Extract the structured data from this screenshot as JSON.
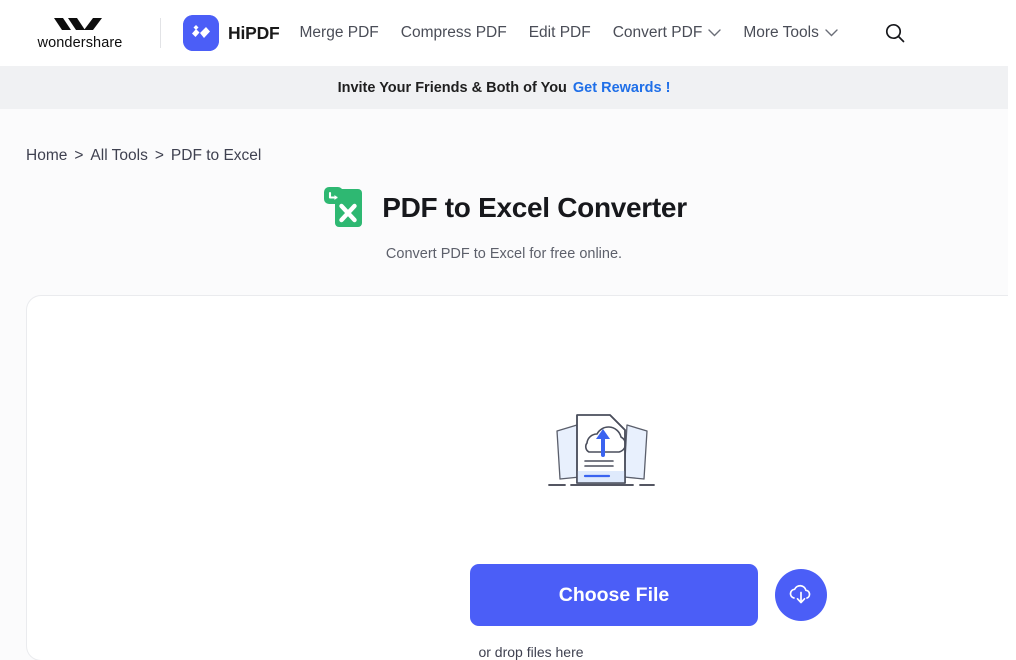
{
  "header": {
    "wondershare_wordmark": "wondershare",
    "brand_name": "HiPDF",
    "nav_items": [
      {
        "label": "Merge PDF",
        "has_chevron": false
      },
      {
        "label": "Compress PDF",
        "has_chevron": false
      },
      {
        "label": "Edit PDF",
        "has_chevron": false
      },
      {
        "label": "Convert PDF",
        "has_chevron": true
      },
      {
        "label": "More Tools",
        "has_chevron": true
      }
    ],
    "search_icon": "search-icon"
  },
  "banner": {
    "text": "Invite Your Friends & Both of You",
    "link": "Get Rewards !"
  },
  "breadcrumb": {
    "items": [
      "Home",
      "All Tools",
      "PDF to Excel"
    ],
    "separator": ">"
  },
  "page": {
    "title": "PDF to Excel Converter",
    "subtitle": "Convert PDF to Excel for free online.",
    "icon": "pdf-to-excel-icon"
  },
  "dropzone": {
    "illustration": "cloud-upload-documents-illustration",
    "choose_file_label": "Choose File",
    "cloud_button_icon": "cloud-download-icon",
    "drop_hint": "or drop files here"
  },
  "colors": {
    "brand_blue": "#4b5ef7",
    "link_blue": "#1f6fe8",
    "excel_green": "#2eb872",
    "banner_bg": "#f0f1f3",
    "page_bg": "#fbfbfc"
  }
}
